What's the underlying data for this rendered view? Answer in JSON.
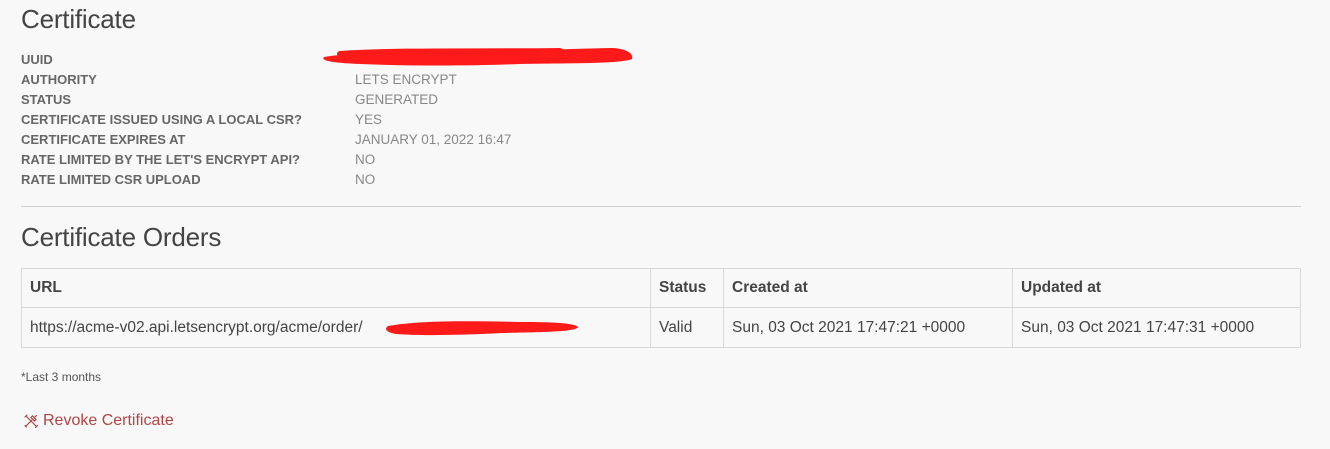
{
  "certificate": {
    "title": "Certificate",
    "details": [
      {
        "key": "UUID",
        "value": ""
      },
      {
        "key": "AUTHORITY",
        "value": "LETS ENCRYPT"
      },
      {
        "key": "STATUS",
        "value": "GENERATED"
      },
      {
        "key": "CERTIFICATE ISSUED USING A LOCAL CSR?",
        "value": "YES"
      },
      {
        "key": "CERTIFICATE EXPIRES AT",
        "value": "JANUARY 01, 2022 16:47"
      },
      {
        "key": "RATE LIMITED BY THE LET'S ENCRYPT API?",
        "value": "NO"
      },
      {
        "key": "RATE LIMITED CSR UPLOAD",
        "value": "NO"
      }
    ]
  },
  "orders": {
    "title": "Certificate Orders",
    "headers": {
      "url": "URL",
      "status": "Status",
      "created": "Created at",
      "updated": "Updated at"
    },
    "rows": [
      {
        "url": "https://acme-v02.api.letsencrypt.org/acme/order/",
        "status": "Valid",
        "created": "Sun, 03 Oct 2021 17:47:21 +0000",
        "updated": "Sun, 03 Oct 2021 17:47:31 +0000"
      }
    ]
  },
  "footnote": "*Last 3 months",
  "actions": {
    "revoke_label": "Revoke Certificate",
    "revoke_icon": "tools-icon"
  },
  "colors": {
    "redaction": "#ff1a1a",
    "revoke_link": "#b04545"
  }
}
